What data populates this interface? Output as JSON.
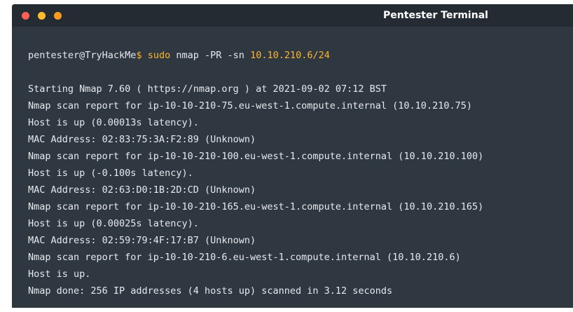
{
  "window": {
    "title": "Pentester Terminal"
  },
  "command_line": {
    "user_host": "pentester@TryHackMe",
    "prompt_sign": "$",
    "sudo": "sudo",
    "command": "nmap -PR -sn",
    "target": "10.10.210.6/24"
  },
  "output": [
    "Starting Nmap 7.60 ( https://nmap.org ) at 2021-09-02 07:12 BST",
    "Nmap scan report for ip-10-10-210-75.eu-west-1.compute.internal (10.10.210.75)",
    "Host is up (0.00013s latency).",
    "MAC Address: 02:83:75:3A:F2:89 (Unknown)",
    "Nmap scan report for ip-10-10-210-100.eu-west-1.compute.internal (10.10.210.100)",
    "Host is up (-0.100s latency).",
    "MAC Address: 02:63:D0:1B:2D:CD (Unknown)",
    "Nmap scan report for ip-10-10-210-165.eu-west-1.compute.internal (10.10.210.165)",
    "Host is up (0.00025s latency).",
    "MAC Address: 02:59:79:4F:17:B7 (Unknown)",
    "Nmap scan report for ip-10-10-210-6.eu-west-1.compute.internal (10.10.210.6)",
    "Host is up.",
    "Nmap done: 256 IP addresses (4 hosts up) scanned in 3.12 seconds"
  ],
  "colors": {
    "background": "#2f3740",
    "titlebar": "#242b33",
    "accent": "#ffb72e",
    "text": "#e6eaee",
    "close_dot": "#ff5f56",
    "minimize_dot": "#ffbd2e",
    "maximize_dot": "#ff9b1f"
  }
}
